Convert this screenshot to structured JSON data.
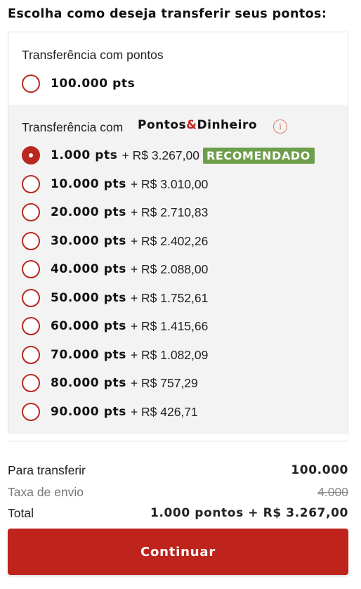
{
  "heading": "Escolha como deseja transferir seus pontos:",
  "points_section": {
    "label": "Transferência com pontos",
    "option": {
      "pts": "100.000 pts",
      "selected": false
    }
  },
  "mixed_section": {
    "label": "Transferência com",
    "brand": {
      "part1": "Pontos",
      "amp": "&",
      "part2": "Dinheiro"
    },
    "info_icon": "info-icon",
    "recommended_badge": "RECOMENDADO",
    "options": [
      {
        "pts": "1.000 pts",
        "money": "+ R$ 3.267,00",
        "selected": true,
        "recommended": true
      },
      {
        "pts": "10.000 pts",
        "money": "+ R$ 3.010,00",
        "selected": false
      },
      {
        "pts": "20.000 pts",
        "money": "+ R$ 2.710,83",
        "selected": false
      },
      {
        "pts": "30.000 pts",
        "money": "+ R$ 2.402,26",
        "selected": false
      },
      {
        "pts": "40.000 pts",
        "money": "+ R$ 2.088,00",
        "selected": false
      },
      {
        "pts": "50.000 pts",
        "money": "+ R$ 1.752,61",
        "selected": false
      },
      {
        "pts": "60.000 pts",
        "money": "+ R$ 1.415,66",
        "selected": false
      },
      {
        "pts": "70.000 pts",
        "money": "+ R$ 1.082,09",
        "selected": false
      },
      {
        "pts": "80.000 pts",
        "money": "+ R$ 757,29",
        "selected": false
      },
      {
        "pts": "90.000 pts",
        "money": "+ R$ 426,71",
        "selected": false
      }
    ]
  },
  "summary": {
    "transfer_label": "Para transferir",
    "transfer_value": "100.000",
    "fee_label": "Taxa de envio",
    "fee_value": "4.000",
    "total_label": "Total",
    "total_value": "1.000 pontos + R$ 3.267,00"
  },
  "continue_label": "Continuar",
  "colors": {
    "accent": "#be231c",
    "badge": "#6e9e4b",
    "panel": "#f3f3f3"
  }
}
